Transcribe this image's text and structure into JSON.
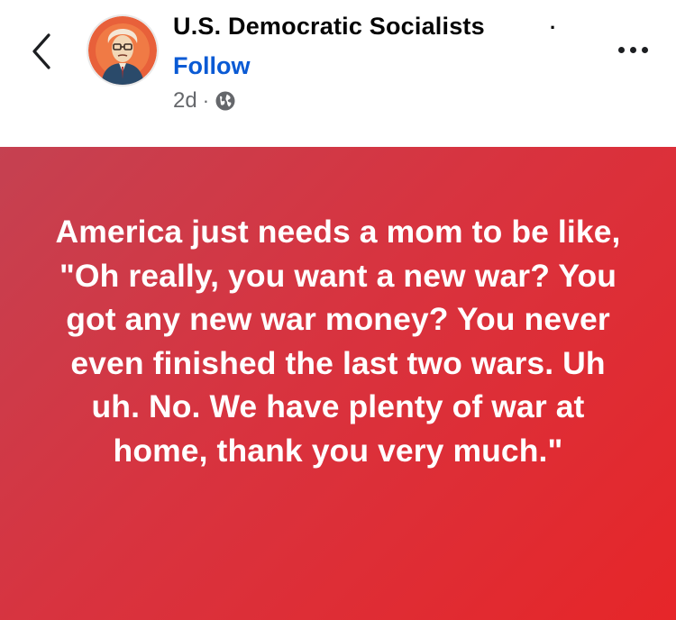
{
  "header": {
    "page_name": "U.S. Democratic Socialists",
    "name_separator": "·",
    "follow_label": "Follow",
    "timestamp": "2d",
    "meta_separator": "·",
    "privacy_icon": "globe-icon",
    "back_icon": "chevron-left-icon",
    "more_icon": "more-horizontal-icon"
  },
  "post": {
    "text": "America just needs a mom to be like, \"Oh really, you want a new war? You got any new war money? You never even finished the last two wars. Uh uh. No. We have plenty of war at home, thank you very much.\"",
    "background_start": "#c54151",
    "background_end": "#e62629",
    "text_color": "#ffffff"
  },
  "colors": {
    "follow": "#0a5ad4",
    "name": "#050505",
    "meta": "#65676b"
  }
}
